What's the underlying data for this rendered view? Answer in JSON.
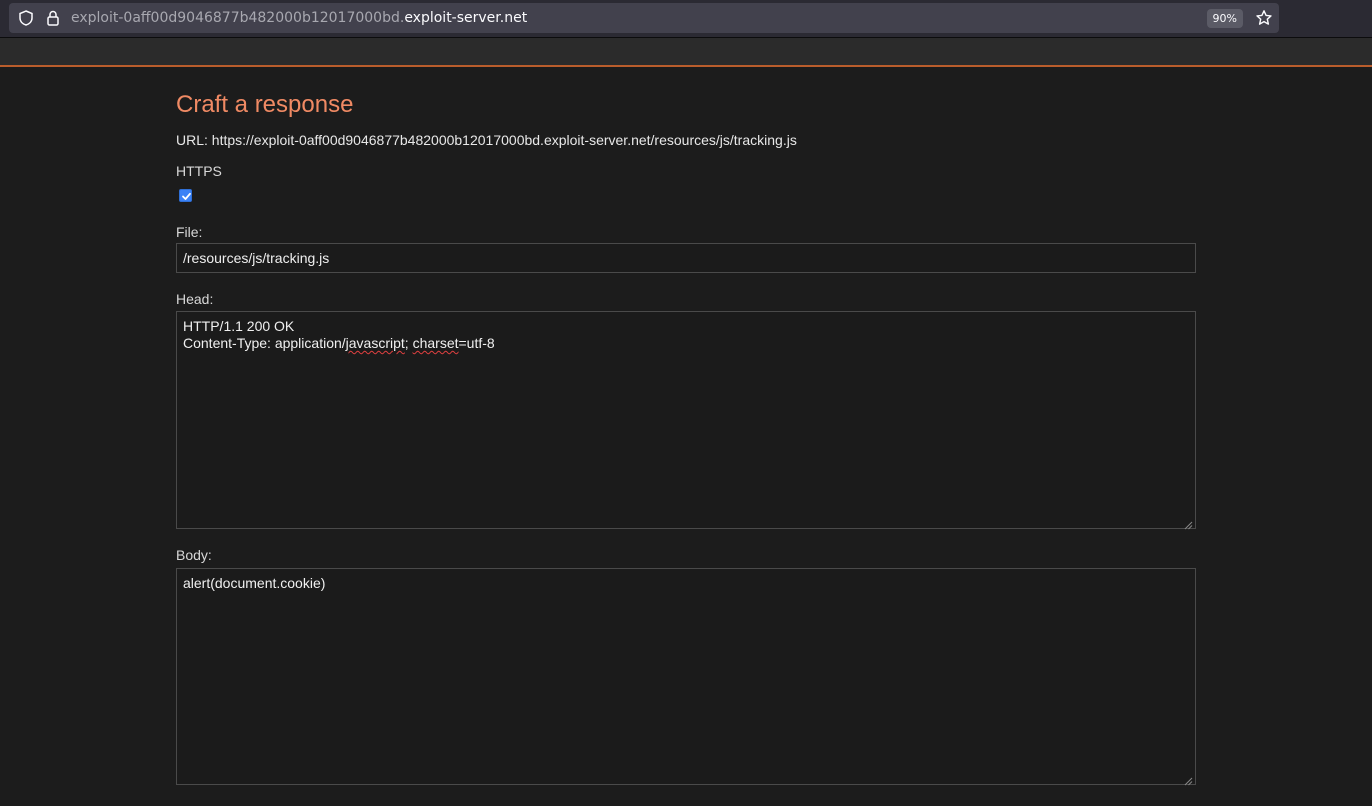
{
  "browser": {
    "url_subdomain": "exploit-0aff00d9046877b482000b12017000bd.",
    "url_domain": "exploit-server.net",
    "zoom": "90%",
    "icons": [
      "shield-icon",
      "lock-icon",
      "star-icon"
    ]
  },
  "page": {
    "title": "Craft a response",
    "url_line": "URL: https://exploit-0aff00d9046877b482000b12017000bd.exploit-server.net/resources/js/tracking.js",
    "https_label": "HTTPS",
    "https_checked": true,
    "file_label": "File:",
    "file_value": "/resources/js/tracking.js",
    "head_label": "Head:",
    "head_line1": "HTTP/1.1 200 OK",
    "head_line2_a": "Content-Type: application/",
    "head_line2_b": "javascript",
    "head_line2_c": "; ",
    "head_line2_d": "charset",
    "head_line2_e": "=utf-8",
    "body_label": "Body:",
    "body_value": "alert(document.cookie)"
  },
  "colors": {
    "accent": "#f08a64",
    "header_border": "#ba5d2c",
    "background": "#1c1c1c",
    "checkbox": "#3b82f6"
  }
}
